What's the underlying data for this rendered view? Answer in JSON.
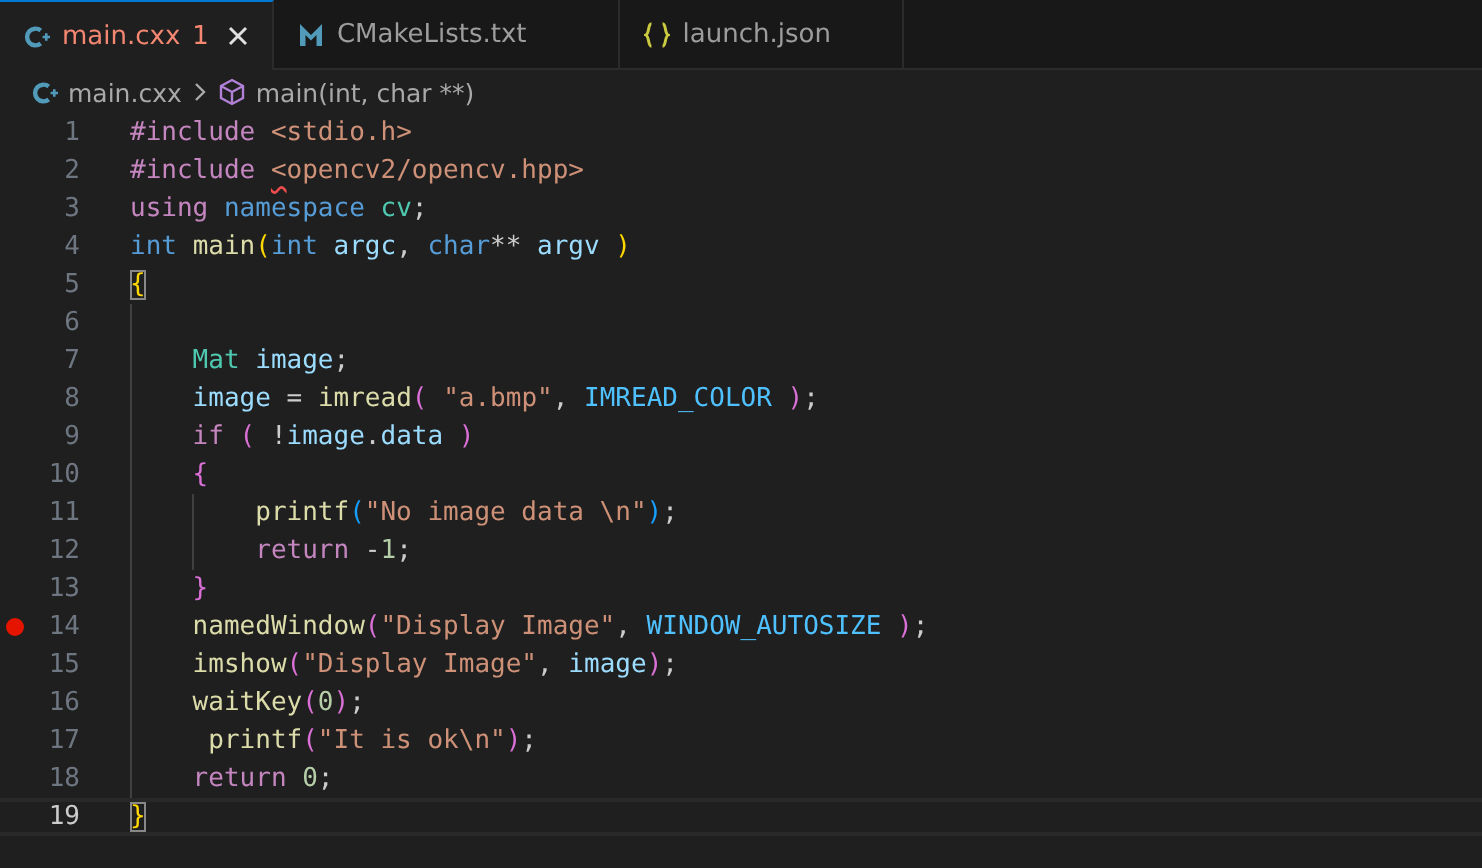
{
  "tabs": [
    {
      "label": "main.cxx",
      "kind": "cpp",
      "selected": true,
      "error": true,
      "problems": "1"
    },
    {
      "label": "CMakeLists.txt",
      "kind": "cmake",
      "selected": false,
      "error": false
    },
    {
      "label": "launch.json",
      "kind": "json",
      "selected": false,
      "error": false
    }
  ],
  "breadcrumb": [
    {
      "label": "main.cxx",
      "kind": "file"
    },
    {
      "label": "main(int, char **)",
      "kind": "symbol"
    }
  ],
  "lines": [
    {
      "number": "1",
      "breakpoint": false,
      "current": false,
      "tokens": [
        {
          "kind": "control",
          "text": "#include"
        },
        {
          "kind": "string",
          "text": " <stdio.h>"
        }
      ]
    },
    {
      "number": "2",
      "breakpoint": false,
      "current": false,
      "tokens": [
        {
          "kind": "control",
          "text": "#include "
        },
        {
          "kind": "string-error",
          "text": "<"
        },
        {
          "kind": "string",
          "text": "opencv2/opencv.hpp>"
        }
      ]
    },
    {
      "number": "3",
      "breakpoint": false,
      "current": false,
      "tokens": [
        {
          "kind": "control",
          "text": "using "
        },
        {
          "kind": "keyword",
          "text": "namespace "
        },
        {
          "kind": "type",
          "text": "cv"
        },
        {
          "kind": "plain",
          "text": ";"
        }
      ]
    },
    {
      "number": "4",
      "breakpoint": false,
      "current": false,
      "tokens": [
        {
          "kind": "keyword",
          "text": "int "
        },
        {
          "kind": "function",
          "text": "main"
        },
        {
          "kind": "bracket1",
          "text": "("
        },
        {
          "kind": "keyword",
          "text": "int "
        },
        {
          "kind": "variable",
          "text": "argc"
        },
        {
          "kind": "plain",
          "text": ", "
        },
        {
          "kind": "keyword",
          "text": "char"
        },
        {
          "kind": "plain",
          "text": "** "
        },
        {
          "kind": "variable",
          "text": "argv "
        },
        {
          "kind": "bracket1",
          "text": ")"
        }
      ]
    },
    {
      "number": "5",
      "breakpoint": false,
      "current": false,
      "tokens": [
        {
          "kind": "bracket1-match",
          "text": "{"
        }
      ]
    },
    {
      "number": "6",
      "breakpoint": false,
      "current": false
    },
    {
      "number": "7",
      "breakpoint": false,
      "current": false,
      "tokens": [
        {
          "kind": "type",
          "text": "    Mat "
        },
        {
          "kind": "variable",
          "text": "image"
        },
        {
          "kind": "plain",
          "text": ";"
        }
      ]
    },
    {
      "number": "8",
      "breakpoint": false,
      "current": false,
      "tokens": [
        {
          "kind": "variable",
          "text": "    image"
        },
        {
          "kind": "plain",
          "text": " = "
        },
        {
          "kind": "function",
          "text": "imread"
        },
        {
          "kind": "bracket2",
          "text": "( "
        },
        {
          "kind": "string",
          "text": "\"a.bmp\""
        },
        {
          "kind": "plain",
          "text": ", "
        },
        {
          "kind": "constant",
          "text": "IMREAD_COLOR "
        },
        {
          "kind": "bracket2",
          "text": ")"
        },
        {
          "kind": "plain",
          "text": ";"
        }
      ]
    },
    {
      "number": "9",
      "breakpoint": false,
      "current": false,
      "tokens": [
        {
          "kind": "control",
          "text": "    if "
        },
        {
          "kind": "bracket2",
          "text": "("
        },
        {
          "kind": "plain",
          "text": " !"
        },
        {
          "kind": "variable",
          "text": "image"
        },
        {
          "kind": "plain",
          "text": "."
        },
        {
          "kind": "variable",
          "text": "data "
        },
        {
          "kind": "bracket2",
          "text": ")"
        }
      ]
    },
    {
      "number": "10",
      "breakpoint": false,
      "current": false,
      "tokens": [
        {
          "kind": "bracket2",
          "text": "    {"
        }
      ]
    },
    {
      "number": "11",
      "breakpoint": false,
      "current": false,
      "tokens": [
        {
          "kind": "function",
          "text": "        printf"
        },
        {
          "kind": "bracket3",
          "text": "("
        },
        {
          "kind": "string",
          "text": "\"No image data \\n\""
        },
        {
          "kind": "bracket3",
          "text": ")"
        },
        {
          "kind": "plain",
          "text": ";"
        }
      ]
    },
    {
      "number": "12",
      "breakpoint": false,
      "current": false,
      "tokens": [
        {
          "kind": "control",
          "text": "        return "
        },
        {
          "kind": "plain",
          "text": "-"
        },
        {
          "kind": "number",
          "text": "1"
        },
        {
          "kind": "plain",
          "text": ";"
        }
      ]
    },
    {
      "number": "13",
      "breakpoint": false,
      "current": false,
      "tokens": [
        {
          "kind": "bracket2",
          "text": "    }"
        }
      ]
    },
    {
      "number": "14",
      "breakpoint": true,
      "current": false,
      "tokens": [
        {
          "kind": "function",
          "text": "    namedWindow"
        },
        {
          "kind": "bracket2",
          "text": "("
        },
        {
          "kind": "string",
          "text": "\"Display Image\""
        },
        {
          "kind": "plain",
          "text": ", "
        },
        {
          "kind": "constant",
          "text": "WINDOW_AUTOSIZE "
        },
        {
          "kind": "bracket2",
          "text": ")"
        },
        {
          "kind": "plain",
          "text": ";"
        }
      ]
    },
    {
      "number": "15",
      "breakpoint": false,
      "current": false,
      "tokens": [
        {
          "kind": "function",
          "text": "    imshow"
        },
        {
          "kind": "bracket2",
          "text": "("
        },
        {
          "kind": "string",
          "text": "\"Display Image\""
        },
        {
          "kind": "plain",
          "text": ", "
        },
        {
          "kind": "variable",
          "text": "image"
        },
        {
          "kind": "bracket2",
          "text": ")"
        },
        {
          "kind": "plain",
          "text": ";"
        }
      ]
    },
    {
      "number": "16",
      "breakpoint": false,
      "current": false,
      "tokens": [
        {
          "kind": "function",
          "text": "    waitKey"
        },
        {
          "kind": "bracket2",
          "text": "("
        },
        {
          "kind": "number",
          "text": "0"
        },
        {
          "kind": "bracket2",
          "text": ")"
        },
        {
          "kind": "plain",
          "text": ";"
        }
      ]
    },
    {
      "number": "17",
      "breakpoint": false,
      "current": false,
      "tokens": [
        {
          "kind": "function",
          "text": "     printf"
        },
        {
          "kind": "bracket2",
          "text": "("
        },
        {
          "kind": "string",
          "text": "\"It is ok\\n\""
        },
        {
          "kind": "bracket2",
          "text": ")"
        },
        {
          "kind": "plain",
          "text": ";"
        }
      ]
    },
    {
      "number": "18",
      "breakpoint": false,
      "current": false,
      "tokens": [
        {
          "kind": "control",
          "text": "    return "
        },
        {
          "kind": "number",
          "text": "0"
        },
        {
          "kind": "plain",
          "text": ";"
        }
      ]
    },
    {
      "number": "19",
      "breakpoint": false,
      "current": true,
      "tokens": [
        {
          "kind": "bracket1-match",
          "text": "}"
        }
      ]
    }
  ]
}
